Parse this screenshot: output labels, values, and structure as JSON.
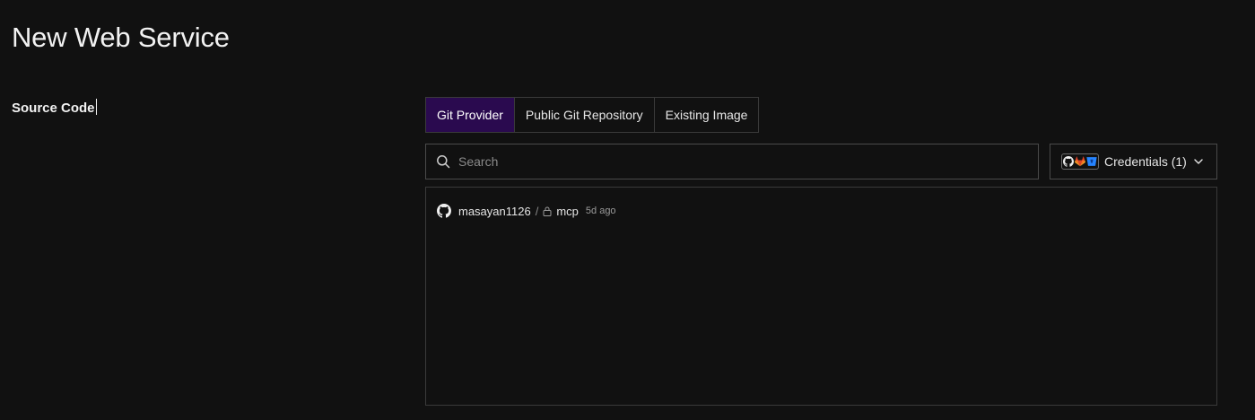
{
  "page": {
    "title": "New Web Service"
  },
  "source_code": {
    "label": "Source Code",
    "tabs": [
      {
        "label": "Git Provider",
        "active": true
      },
      {
        "label": "Public Git Repository",
        "active": false
      },
      {
        "label": "Existing Image",
        "active": false
      }
    ],
    "search": {
      "placeholder": "Search",
      "value": "",
      "icon": "search-icon"
    },
    "credentials": {
      "label": "Credentials (1)",
      "icons": [
        "github-icon",
        "gitlab-icon",
        "bitbucket-icon"
      ],
      "chevron_icon": "chevron-down-icon"
    },
    "repositories": [
      {
        "provider_icon": "github-icon",
        "owner": "masayan1126",
        "separator": "/",
        "visibility_icon": "lock-icon",
        "name": "mcp",
        "updated": "5d ago"
      }
    ]
  },
  "colors": {
    "background": "#111111",
    "active_tab": "#2a0a4f",
    "border": "#3a3a3a",
    "text": "#e6e6e6",
    "muted_text": "#9a9a9a",
    "gitlab": "#e24329",
    "bitbucket": "#2684ff"
  }
}
